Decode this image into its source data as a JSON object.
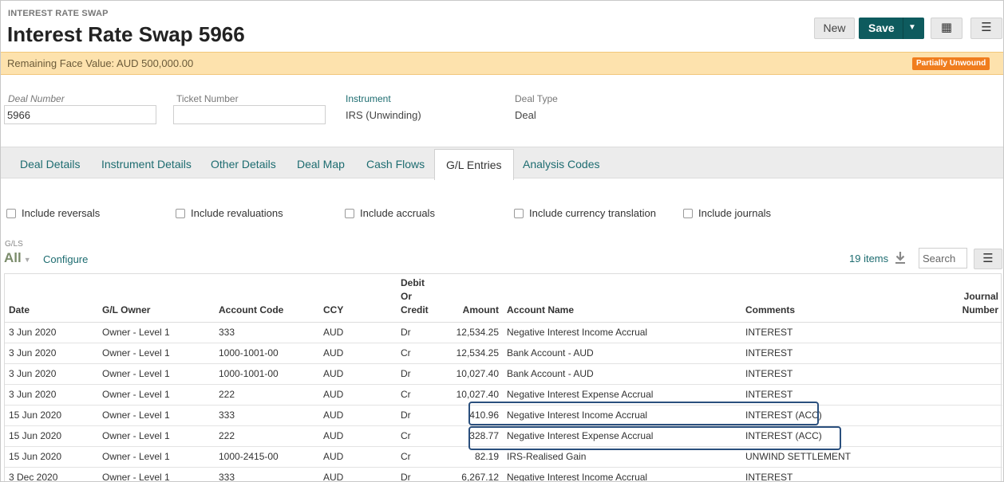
{
  "header": {
    "kicker": "INTEREST RATE SWAP",
    "title": "Interest Rate Swap 5966",
    "new_label": "New",
    "save_label": "Save",
    "grid_icon": "grid-icon",
    "menu_icon": "menu-icon"
  },
  "banner": {
    "text": "Remaining Face Value: AUD 500,000.00",
    "badge": "Partially Unwound",
    "badge_color": "#f07d1e"
  },
  "fields": {
    "deal_number": {
      "label": "Deal Number",
      "value": "5966"
    },
    "ticket_number": {
      "label": "Ticket Number",
      "value": ""
    },
    "instrument": {
      "label": "Instrument",
      "value": "IRS (Unwinding)"
    },
    "deal_type": {
      "label": "Deal Type",
      "value": "Deal"
    }
  },
  "tabs": [
    {
      "label": "Deal Details"
    },
    {
      "label": "Instrument Details"
    },
    {
      "label": "Other Details"
    },
    {
      "label": "Deal Map"
    },
    {
      "label": "Cash Flows"
    },
    {
      "label": "G/L Entries",
      "active": true
    },
    {
      "label": "Analysis Codes"
    }
  ],
  "filters": [
    {
      "label": "Include reversals",
      "checked": false
    },
    {
      "label": "Include revaluations",
      "checked": false
    },
    {
      "label": "Include accruals",
      "checked": false
    },
    {
      "label": "Include currency translation",
      "checked": false
    },
    {
      "label": "Include journals",
      "checked": false
    }
  ],
  "gl_toolbar": {
    "section_label": "G/LS",
    "view": "All",
    "configure": "Configure",
    "count": "19 items",
    "search_placeholder": "Search"
  },
  "table": {
    "columns": [
      "Date",
      "G/L Owner",
      "Account Code",
      "CCY",
      "Debit Or Credit",
      "Amount",
      "Account Name",
      "Comments",
      "Journal Number"
    ],
    "header_lines": {
      "debit_or_credit": [
        "Debit",
        "Or",
        "Credit"
      ],
      "journal_number": [
        "Journal",
        "Number"
      ]
    },
    "rows": [
      [
        "3 Jun 2020",
        "Owner - Level 1",
        "333",
        "AUD",
        "Dr",
        "12,534.25",
        "Negative Interest Income Accrual",
        "INTEREST",
        ""
      ],
      [
        "3 Jun 2020",
        "Owner - Level 1",
        "1000-1001-00",
        "AUD",
        "Cr",
        "12,534.25",
        "Bank Account - AUD",
        "INTEREST",
        ""
      ],
      [
        "3 Jun 2020",
        "Owner - Level 1",
        "1000-1001-00",
        "AUD",
        "Dr",
        "10,027.40",
        "Bank Account - AUD",
        "INTEREST",
        ""
      ],
      [
        "3 Jun 2020",
        "Owner - Level 1",
        "222",
        "AUD",
        "Cr",
        "10,027.40",
        "Negative Interest Expense Accrual",
        "INTEREST",
        ""
      ],
      [
        "15 Jun 2020",
        "Owner - Level 1",
        "333",
        "AUD",
        "Dr",
        "410.96",
        "Negative Interest Income Accrual",
        "INTEREST (ACC)",
        ""
      ],
      [
        "15 Jun 2020",
        "Owner - Level 1",
        "222",
        "AUD",
        "Cr",
        "328.77",
        "Negative Interest Expense Accrual",
        "INTEREST (ACC)",
        ""
      ],
      [
        "15 Jun 2020",
        "Owner - Level 1",
        "1000-2415-00",
        "AUD",
        "Cr",
        "82.19",
        "IRS-Realised Gain",
        "UNWIND SETTLEMENT",
        ""
      ],
      [
        "3 Dec 2020",
        "Owner - Level 1",
        "333",
        "AUD",
        "Dr",
        "6,267.12",
        "Negative Interest Income Accrual",
        "INTEREST",
        ""
      ]
    ],
    "highlighted_rows": [
      4,
      5
    ],
    "highlight_color": "#2a4f7d"
  }
}
